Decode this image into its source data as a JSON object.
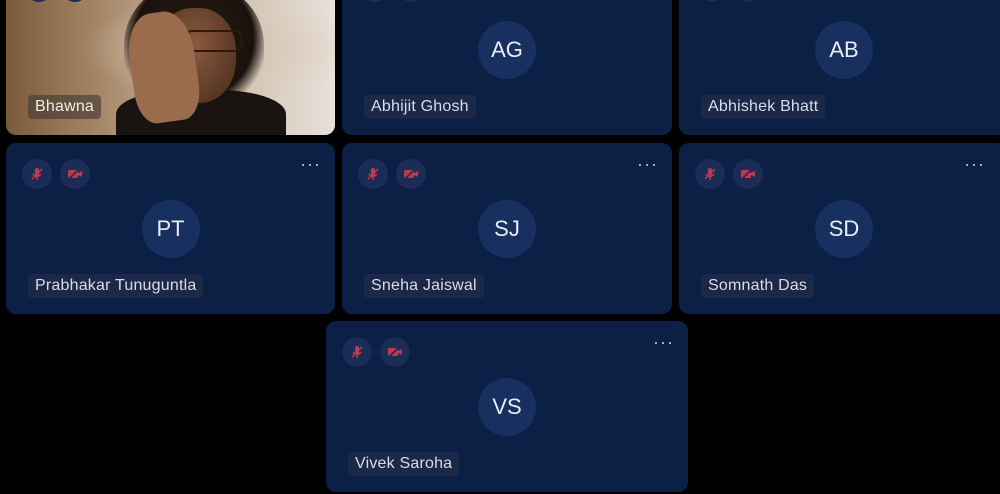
{
  "participants": [
    {
      "name": "Bhawna",
      "initials": ""
    },
    {
      "name": "Abhijit Ghosh",
      "initials": "AG"
    },
    {
      "name": "Abhishek Bhatt",
      "initials": "AB"
    },
    {
      "name": "Prabhakar Tunuguntla",
      "initials": "PT"
    },
    {
      "name": "Sneha Jaiswal",
      "initials": "SJ"
    },
    {
      "name": "Somnath Das",
      "initials": "SD"
    },
    {
      "name": "Vivek Saroha",
      "initials": "VS"
    }
  ],
  "icons": {
    "mic": "mic-off-icon",
    "camera": "camera-off-icon",
    "more": "more-options-icon"
  },
  "colors": {
    "tile_bg": "#0c1f45",
    "avatar_bg": "#18305f",
    "muted_icon": "#c0394f"
  }
}
